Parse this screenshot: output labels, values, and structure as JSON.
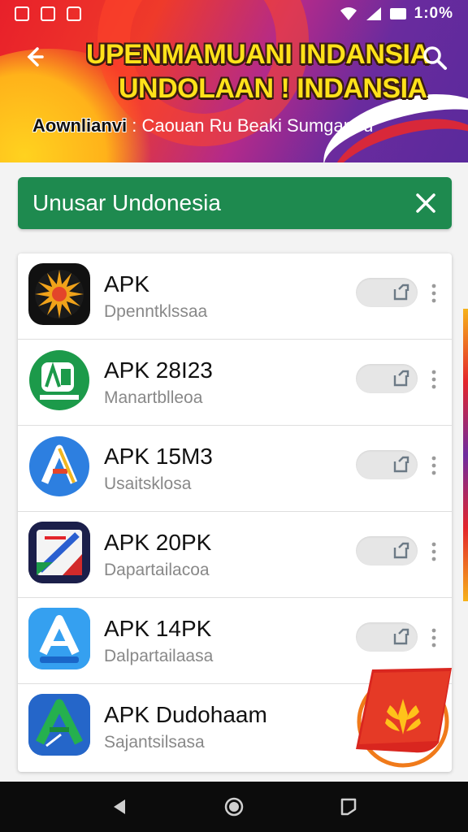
{
  "status_bar": {
    "time": "1:0%",
    "left_icons": [
      "notification-icon",
      "notification-icon",
      "lock-icon"
    ],
    "right_icons": [
      "wifi-icon",
      "signal-icon",
      "battery-icon"
    ]
  },
  "header": {
    "title_line_1": "UPENMAMUANI INDANSIA",
    "title_line_2": "UNDOLAAN ! INDANSIA",
    "subtitle_bold": "Aownlianvi",
    "subtitle_rest": ": Caouan Ru Beaki Sumganiru",
    "colors": {
      "title": "#ffe21a",
      "red": "#e8202a",
      "purple": "#5a2a9c",
      "yellow": "#ffd21f"
    }
  },
  "filter_bar": {
    "label": "Unusar Undonesia",
    "color": "#1e8a4f"
  },
  "apps": [
    {
      "name": "APK",
      "desc": "Dpenntklssaa",
      "icon": "sunburst-app-icon"
    },
    {
      "name": "APK 28I23",
      "desc": "Manartblleoa",
      "icon": "green-logo-app-icon"
    },
    {
      "name": "APK 15M3",
      "desc": "Usaitsklosa",
      "icon": "blue-a-app-icon"
    },
    {
      "name": "APK 20PK",
      "desc": "Dapartailacoa",
      "icon": "navy-card-app-icon"
    },
    {
      "name": "APK 14PK",
      "desc": "Dalpartailaasa",
      "icon": "light-blue-a-app-icon"
    },
    {
      "name": "APK  Dudohaam",
      "desc": "Sajantsilsasa",
      "icon": "green-arrow-app-icon"
    }
  ],
  "fab": {
    "icon": "wheat-icon",
    "color": "#e22a22"
  },
  "navbar": {
    "buttons": [
      "back-nav-icon",
      "home-nav-icon",
      "recents-nav-icon"
    ]
  }
}
